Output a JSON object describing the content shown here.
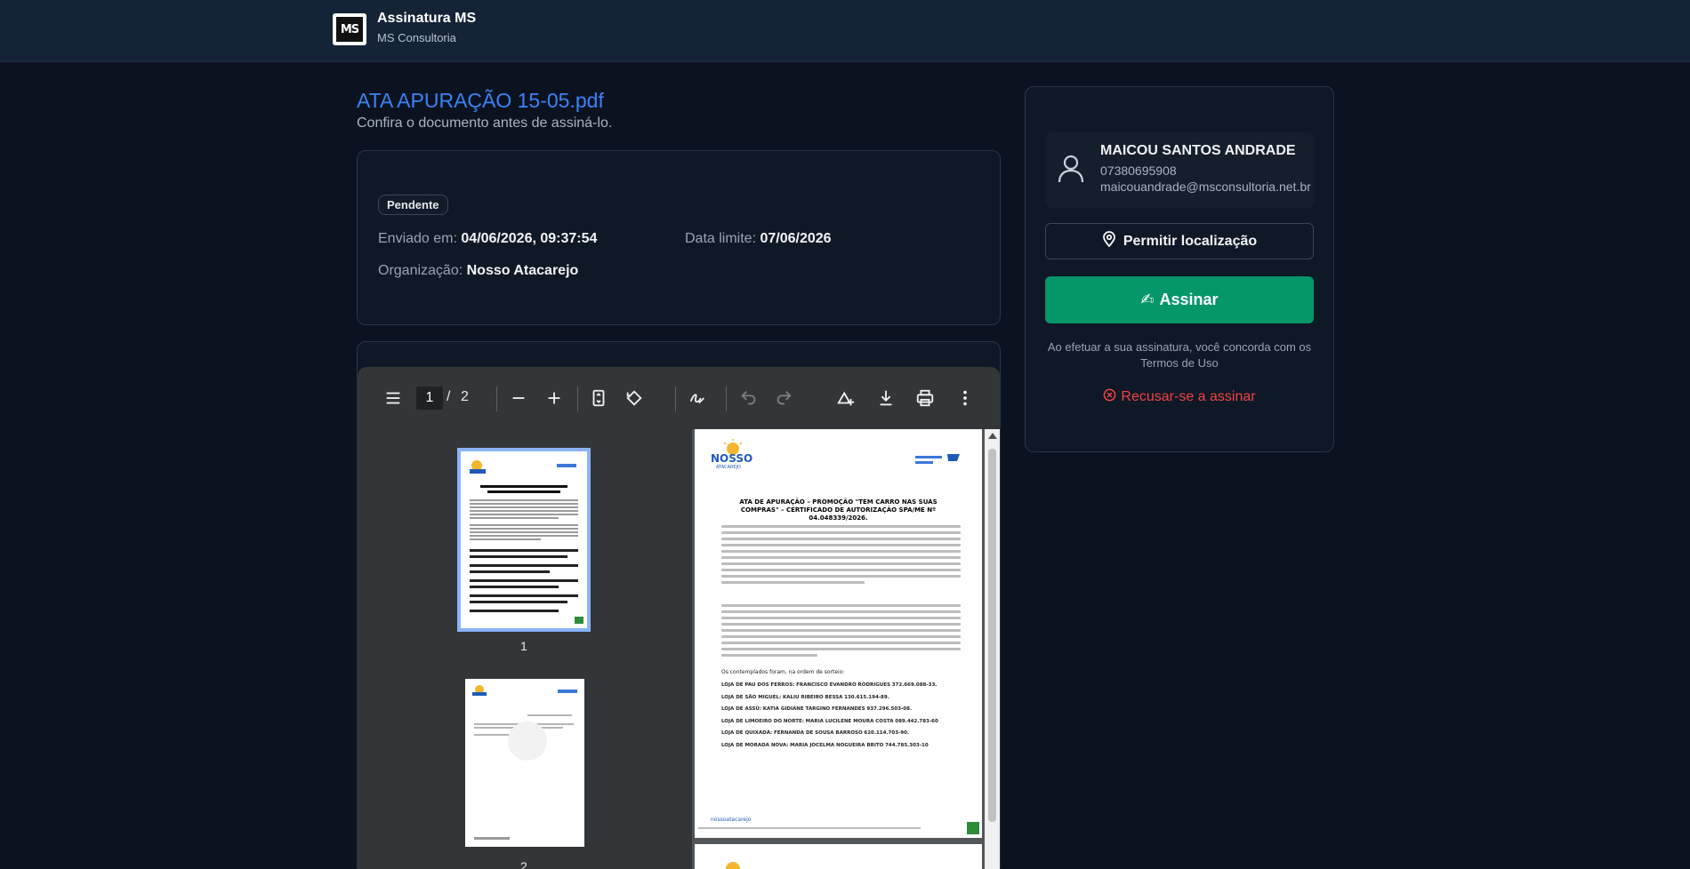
{
  "header": {
    "app_title": "Assinatura MS",
    "company": "MS Consultoria",
    "logo_text": "MS"
  },
  "document": {
    "file_name": "ATA APURAÇÃO 15-05.pdf",
    "subtitle": "Confira o documento antes de assiná-lo.",
    "status": "Pendente",
    "sent_label": "Enviado em:",
    "sent_value": "04/06/2026, 09:37:54",
    "deadline_label": "Data limite:",
    "deadline_value": "07/06/2026",
    "org_label": "Organização:",
    "org_value": "Nosso Atacarejo"
  },
  "viewer": {
    "current_page": "1",
    "separator": "/",
    "total_pages": "2",
    "thumbnails": [
      {
        "number": "1",
        "selected": true
      },
      {
        "number": "2",
        "selected": false
      }
    ],
    "page_content": {
      "brand": "NOSSO",
      "brand_sub": "ATACAREJO",
      "heading": "ATA DE APURAÇÃO – PROMOÇÃO \"TEM CARRO NAS SUAS COMPRAS\" – CERTIFICADO DE AUTORIZAÇÃO SPA/ME Nº 04.048339/2026.",
      "winners_intro": "Os contemplados foram, na ordem de sorteio:",
      "winners": [
        {
          "store": "LOJA DE PAU DOS FERROS:",
          "name": "FRANCISCO EVANDRO RODRIGUES",
          "cpf": "372.669.088-33."
        },
        {
          "store": "LOJA DE SÃO MIGUEL:",
          "name": "KALIU RIBEIRO BESSA",
          "cpf": "130.615.194-89."
        },
        {
          "store": "LOJA DE ASSÚ:",
          "name": "KATIA GIDIANE TARGINO FERNANDES",
          "cpf": "937.296.503-08."
        },
        {
          "store": "LOJA DE LIMOEIRO DO NORTE:",
          "name": "MARIA LUCILENE MOURA COSTA",
          "cpf": "089.442.783-60"
        },
        {
          "store": "LOJA DE QUIXADÁ:",
          "name": "FERNANDA DE SOUSA BARROSO",
          "cpf": "620.114.703-90."
        },
        {
          "store": "LOJA DE MORADA NOVA:",
          "name": "MARIA JOCELMA NOGUEIRA BRITO",
          "cpf": "744.785.303-10"
        }
      ],
      "footer_social": "nossoatacarejo"
    }
  },
  "signer": {
    "name": "MAICOU SANTOS ANDRADE",
    "document": "07380695908",
    "email": "maicouandrade@msconsultoria.net.br",
    "location_button": "Permitir localização",
    "sign_button": "Assinar",
    "sign_emoji": "✍",
    "terms_line1": "Ao efetuar a sua assinatura, você concorda com os",
    "terms_line2": "Termos de Uso",
    "refuse_link": "Recusar-se a assinar"
  },
  "colors": {
    "accent_blue": "#3b82f6",
    "sign_green": "#059669",
    "refuse_red": "#ef4444",
    "background": "#0c1320"
  },
  "icons": [
    "hamburger-menu-icon",
    "zoom-out-icon",
    "zoom-in-icon",
    "fit-page-icon",
    "rotate-icon",
    "draw-icon",
    "undo-icon",
    "redo-icon",
    "add-annotation-icon",
    "download-icon",
    "print-icon",
    "more-options-icon",
    "user-icon",
    "location-pin-icon",
    "x-circle-icon"
  ]
}
